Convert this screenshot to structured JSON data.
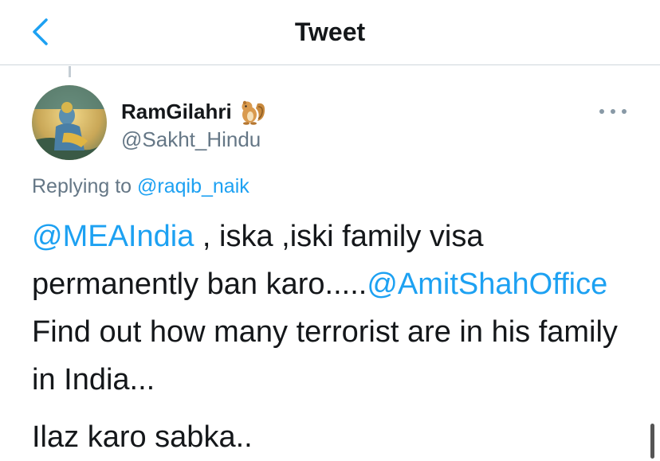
{
  "header": {
    "title": "Tweet",
    "back_icon": "chevron-left-icon"
  },
  "tweet": {
    "author": {
      "name": "RamGilahri",
      "name_emoji": "chipmunk-emoji",
      "handle": "@Sakht_Hindu"
    },
    "replying_to": {
      "prefix": "Replying to ",
      "handle": "@raqib_naik"
    },
    "body": {
      "mention_1": "@MEAIndia",
      "text_1": " , iska ,iski family visa permanently ban karo.....",
      "mention_2": "@AmitShahOffice",
      "text_2": " Find out how many terrorist are in his family in India...",
      "paragraph_2": "Ilaz karo sabka.."
    },
    "more_icon": "more-horizontal-icon"
  },
  "colors": {
    "accent": "#1da1f2",
    "secondary_text": "#657786",
    "primary_text": "#14171a",
    "divider": "#cfd6dc"
  }
}
